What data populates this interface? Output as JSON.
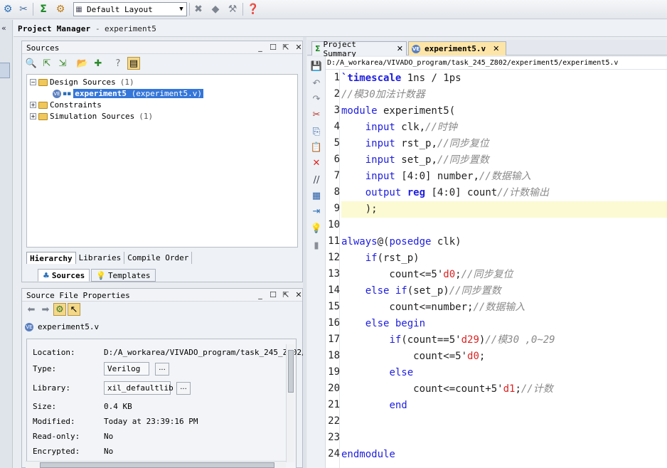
{
  "toolbar": {
    "layout_value": "Default Layout",
    "icons": [
      "settings-icon",
      "tools-icon",
      "sigma-icon",
      "gear-icon",
      "layout-icon",
      "pin-icon",
      "diamond-icon",
      "hammer-icon",
      "help-icon"
    ]
  },
  "project_manager": {
    "title": "Project Manager",
    "separator": "-",
    "project_name": "experiment5"
  },
  "sources": {
    "title": "Sources",
    "tree": {
      "design_sources": "Design Sources",
      "design_sources_count": "(1)",
      "file_name": "experiment5",
      "file_sub": "(experiment5.v)",
      "constraints": "Constraints",
      "simulation_sources": "Simulation Sources",
      "simulation_sources_count": "(1)"
    },
    "view_tabs": [
      "Hierarchy",
      "Libraries",
      "Compile Order"
    ],
    "bottom_tabs": [
      "Sources",
      "Templates"
    ]
  },
  "properties": {
    "title": "Source File Properties",
    "file": "experiment5.v",
    "location_label": "Location:",
    "location_value": "D:/A_workarea/VIVADO_program/task_245_Z802/",
    "type_label": "Type:",
    "type_value": "Verilog",
    "library_label": "Library:",
    "library_value": "xil_defaultlib",
    "size_label": "Size:",
    "size_value": "0.4 KB",
    "modified_label": "Modified:",
    "modified_value": "Today at 23:39:16 PM",
    "readonly_label": "Read-only:",
    "readonly_value": "No",
    "encrypted_label": "Encrypted:",
    "encrypted_value": "No",
    "dots": "..."
  },
  "editor": {
    "tabs": [
      {
        "label": "Project Summary",
        "active": false
      },
      {
        "label": "experiment5.v",
        "active": true
      }
    ],
    "path": "D:/A_workarea/VIVADO_program/task_245_Z802/experiment5/experiment5.v",
    "highlight_line": 9,
    "lines": [
      {
        "n": "1",
        "parts": [
          [
            "kwb",
            "`timescale"
          ],
          [
            "plain",
            " 1ns / 1ps"
          ]
        ]
      },
      {
        "n": "2",
        "parts": [
          [
            "cm",
            "//模30加法计数器"
          ]
        ]
      },
      {
        "n": "3",
        "parts": [
          [
            "kw",
            "module"
          ],
          [
            "plain",
            " experiment5("
          ]
        ]
      },
      {
        "n": "4",
        "parts": [
          [
            "plain",
            "    "
          ],
          [
            "kw",
            "input"
          ],
          [
            "plain",
            " clk,"
          ],
          [
            "cm",
            "//时钟"
          ]
        ]
      },
      {
        "n": "5",
        "parts": [
          [
            "plain",
            "    "
          ],
          [
            "kw",
            "input"
          ],
          [
            "plain",
            " rst_p,"
          ],
          [
            "cm",
            "//同步复位"
          ]
        ]
      },
      {
        "n": "6",
        "parts": [
          [
            "plain",
            "    "
          ],
          [
            "kw",
            "input"
          ],
          [
            "plain",
            " set_p,"
          ],
          [
            "cm",
            "//同步置数"
          ]
        ]
      },
      {
        "n": "7",
        "parts": [
          [
            "plain",
            "    "
          ],
          [
            "kw",
            "input"
          ],
          [
            "plain",
            " [4:0] number,"
          ],
          [
            "cm",
            "//数据输入"
          ]
        ]
      },
      {
        "n": "8",
        "parts": [
          [
            "plain",
            "    "
          ],
          [
            "kw",
            "output"
          ],
          [
            "plain",
            " "
          ],
          [
            "kwb",
            "reg"
          ],
          [
            "plain",
            " [4:0] count"
          ],
          [
            "cm",
            "//计数输出"
          ]
        ]
      },
      {
        "n": "9",
        "parts": [
          [
            "plain",
            "    );"
          ]
        ]
      },
      {
        "n": "10",
        "parts": [
          [
            "plain",
            ""
          ]
        ]
      },
      {
        "n": "11",
        "parts": [
          [
            "kw",
            "always"
          ],
          [
            "plain",
            "@("
          ],
          [
            "kw",
            "posedge"
          ],
          [
            "plain",
            " clk)"
          ]
        ]
      },
      {
        "n": "12",
        "parts": [
          [
            "plain",
            "    "
          ],
          [
            "kw",
            "if"
          ],
          [
            "plain",
            "(rst_p)"
          ]
        ]
      },
      {
        "n": "13",
        "parts": [
          [
            "plain",
            "        count<=5'"
          ],
          [
            "num",
            "d0"
          ],
          [
            "plain",
            ";"
          ],
          [
            "cm",
            "//同步复位"
          ]
        ]
      },
      {
        "n": "14",
        "parts": [
          [
            "plain",
            "    "
          ],
          [
            "kw",
            "else if"
          ],
          [
            "plain",
            "(set_p)"
          ],
          [
            "cm",
            "//同步置数"
          ]
        ]
      },
      {
        "n": "15",
        "parts": [
          [
            "plain",
            "        count<=number;"
          ],
          [
            "cm",
            "//数据输入"
          ]
        ]
      },
      {
        "n": "16",
        "parts": [
          [
            "plain",
            "    "
          ],
          [
            "kw",
            "else begin"
          ]
        ]
      },
      {
        "n": "17",
        "parts": [
          [
            "plain",
            "        "
          ],
          [
            "kw",
            "if"
          ],
          [
            "plain",
            "(count==5'"
          ],
          [
            "num",
            "d29"
          ],
          [
            "plain",
            ")"
          ],
          [
            "cm",
            "//模30 ,0~29"
          ]
        ]
      },
      {
        "n": "18",
        "parts": [
          [
            "plain",
            "            count<=5'"
          ],
          [
            "num",
            "d0"
          ],
          [
            "plain",
            ";"
          ]
        ]
      },
      {
        "n": "19",
        "parts": [
          [
            "plain",
            "        "
          ],
          [
            "kw",
            "else"
          ]
        ]
      },
      {
        "n": "20",
        "parts": [
          [
            "plain",
            "            count<=count+5'"
          ],
          [
            "num",
            "d1"
          ],
          [
            "plain",
            ";"
          ],
          [
            "cm",
            "//计数"
          ]
        ]
      },
      {
        "n": "21",
        "parts": [
          [
            "plain",
            "        "
          ],
          [
            "kw",
            "end"
          ]
        ]
      },
      {
        "n": "22",
        "parts": [
          [
            "plain",
            ""
          ]
        ]
      },
      {
        "n": "23",
        "parts": [
          [
            "plain",
            ""
          ]
        ]
      },
      {
        "n": "24",
        "parts": [
          [
            "kw",
            "endmodule"
          ]
        ]
      }
    ]
  },
  "colors": {
    "keyword": "#1e1ee0",
    "comment": "#8a8a8a",
    "number": "#dd2222",
    "selection": "#3476d9",
    "active_tab": "#fde5a8",
    "current_line": "#fbfad2"
  }
}
